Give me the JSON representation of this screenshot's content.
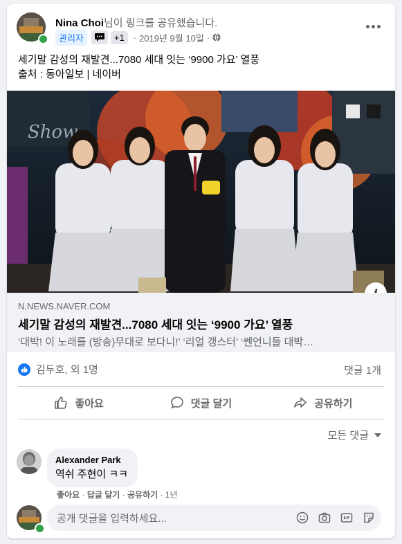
{
  "post": {
    "author": "Nina Choi",
    "action_text": "님이 링크를 공유했습니다.",
    "admin_badge": "관리자",
    "plus_badge": "+1",
    "date": "2019년 9월 10일",
    "dot": "·",
    "text_line1": "세기말 감성의 재발견...7080 세대 잇는 ‘9900 가요’ 열풍",
    "text_line2": "출처 : 동아일보 | 네이버"
  },
  "link": {
    "domain": "N.NEWS.NAVER.COM",
    "title": "세기말 감성의 재발견...7080 세대 잇는 ‘9900 가요’ 열풍",
    "description": "‘대박! 이 노래를 (방송)무대로 보다니!’ ‘리얼 갱스터’ ‘쎈언니들 대박…",
    "info_icon": "i",
    "image_sign_text": "Show"
  },
  "reactions": {
    "summary": "김두호, 외 1명",
    "comment_count": "댓글 1개"
  },
  "actions": {
    "like": "좋아요",
    "comment": "댓글 달기",
    "share": "공유하기"
  },
  "comments": {
    "sort_label": "모든 댓글",
    "items": [
      {
        "name": "Alexander Park",
        "text": "역쉬 주현이 ㅋㅋ",
        "like": "좋아요",
        "reply": "답글 달기",
        "share": "공유하기",
        "time": "1년"
      }
    ]
  },
  "composer": {
    "placeholder": "공개 댓글을 입력하세요..."
  },
  "colors": {
    "accent": "#1877f2",
    "online": "#31a24c",
    "secondary_text": "#65676b"
  }
}
